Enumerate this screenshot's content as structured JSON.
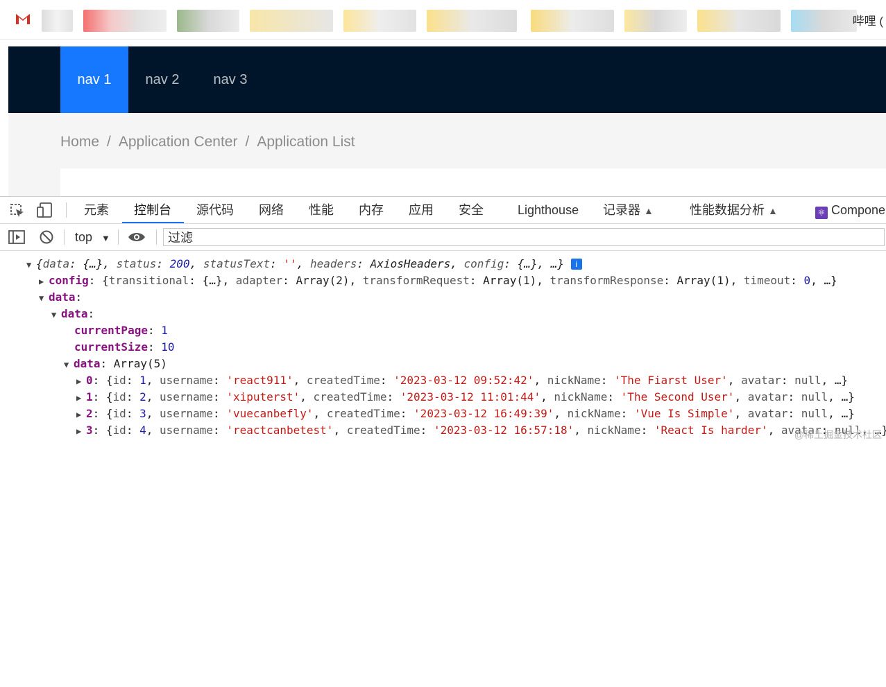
{
  "bookmarks_tail": "哔哩 (",
  "header": {
    "nav": [
      "nav 1",
      "nav 2",
      "nav 3"
    ]
  },
  "breadcrumb": {
    "items": [
      "Home",
      "Application Center",
      "Application List"
    ],
    "separator": "/"
  },
  "devtools": {
    "tabs": [
      "元素",
      "控制台",
      "源代码",
      "网络",
      "性能",
      "内存",
      "应用",
      "安全",
      "Lighthouse",
      "记录器",
      "性能数据分析",
      "Compone"
    ],
    "active_tab": "控制台",
    "context": "top",
    "filter_placeholder": "过滤"
  },
  "console": {
    "root": {
      "summary_open": "{",
      "data_key": "data",
      "data_val": "{…}",
      "status_key": "status",
      "status_val": "200",
      "statusText_key": "statusText",
      "statusText_val": "''",
      "headers_key": "headers",
      "headers_val": "AxiosHeaders",
      "config_key": "config",
      "config_val": "{…}",
      "ellipsis": "…}"
    },
    "config_line": {
      "key": "config",
      "transitional": "{…}",
      "adapter": "Array(2)",
      "transformRequest": "Array(1)",
      "transformResponse": "Array(1)",
      "timeout": "0"
    },
    "data_key": "data",
    "inner_data_key": "data",
    "currentPage_key": "currentPage",
    "currentPage": "1",
    "currentSize_key": "currentSize",
    "currentSize": "10",
    "array_key": "data",
    "array_label": "Array(5)",
    "items": [
      {
        "index": "0",
        "id": "1",
        "username": "'react911'",
        "createdTime": "'2023-03-12 09:52:42'",
        "nickName": "'The Fiarst User'"
      },
      {
        "index": "1",
        "id": "2",
        "username": "'xiputerst'",
        "createdTime": "'2023-03-12 11:01:44'",
        "nickName": "'The Second User'"
      },
      {
        "index": "2",
        "id": "3",
        "username": "'vuecanbefly'",
        "createdTime": "'2023-03-12 16:49:39'",
        "nickName": "'Vue Is Simple'"
      },
      {
        "index": "3",
        "id": "4",
        "username": "'reactcanbetest'",
        "createdTime": "'2023-03-12 16:57:18'",
        "nickName": "'React Is harder'"
      }
    ],
    "avatar_val": "null"
  },
  "watermark": "@稀土掘金技术社区"
}
